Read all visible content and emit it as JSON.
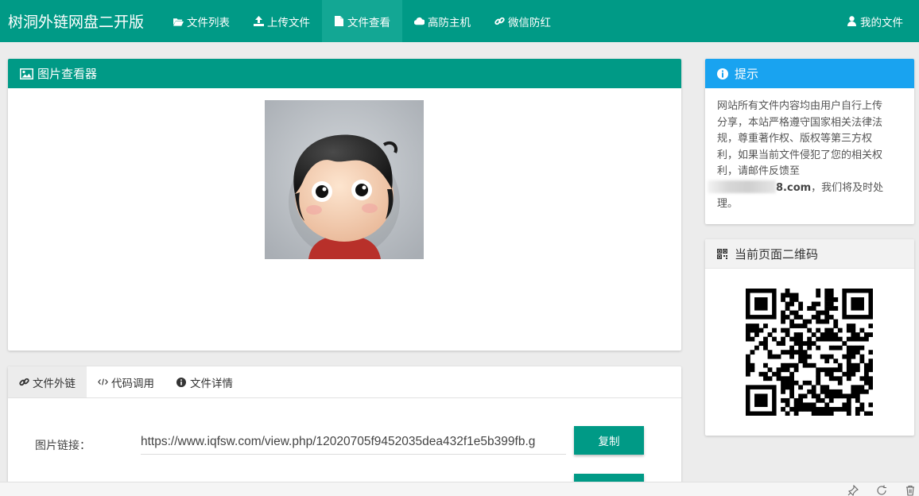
{
  "brand": "树洞外链网盘二开版",
  "nav": {
    "items": [
      {
        "label": "文件列表",
        "icon": "folder-open-icon"
      },
      {
        "label": "上传文件",
        "icon": "upload-icon"
      },
      {
        "label": "文件查看",
        "icon": "file-icon"
      },
      {
        "label": "高防主机",
        "icon": "cloud-icon"
      },
      {
        "label": "微信防红",
        "icon": "link-icon"
      }
    ],
    "active_index": 2,
    "user_label": "我的文件"
  },
  "viewer": {
    "title": "图片查看器"
  },
  "tips": {
    "title": "提示",
    "text_before": "网站所有文件内容均由用户自行上传分享，本站严格遵守国家相关法律法规，尊重著作权、版权等第三方权利，如果当前文件侵犯了您的相关权利，请邮件反馈至",
    "email_visible": "8.com",
    "text_after": "，我们将及时处理。"
  },
  "qr": {
    "title": "当前页面二维码"
  },
  "file_tabs": {
    "items": [
      {
        "label": "文件外链",
        "icon": "link-icon"
      },
      {
        "label": "代码调用",
        "icon": "code-icon"
      },
      {
        "label": "文件详情",
        "icon": "info-icon"
      }
    ],
    "active_index": 0
  },
  "link": {
    "label": "图片链接：",
    "value": "https://www.iqfsw.com/view.php/12020705f9452035dea432f1e5b399fb.g",
    "copy_label": "复制"
  },
  "colors": {
    "primary": "#009a86",
    "info": "#19a3f0"
  }
}
